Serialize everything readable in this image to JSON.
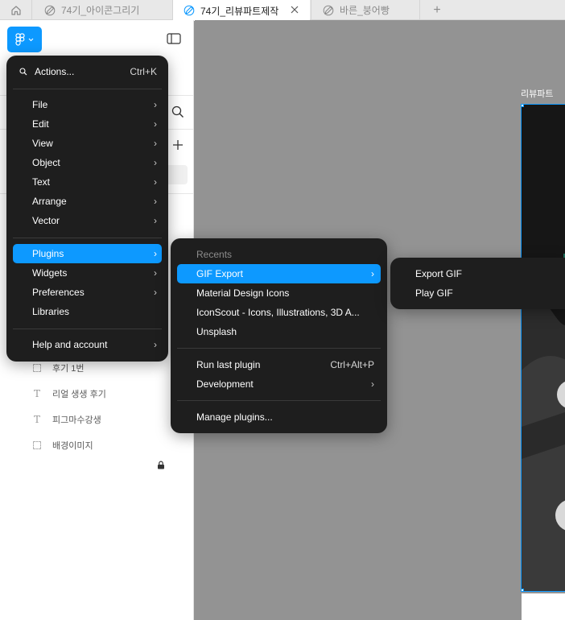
{
  "tabs": {
    "home_icon": "home-icon",
    "items": [
      {
        "label": "74기_아이콘그리기"
      },
      {
        "label": "74기_리뷰파트제작",
        "active": true
      },
      {
        "label": "바른_붕어빵"
      }
    ],
    "new_tab_symbol": "+"
  },
  "canvas": {
    "frame_label": "리뷰파트"
  },
  "layers": [
    {
      "name": "후기 1번",
      "type": "frame"
    },
    {
      "name": "리얼 생생 후기",
      "type": "text"
    },
    {
      "name": "피그마수강생",
      "type": "text"
    },
    {
      "name": "배경이미지",
      "type": "frame",
      "locked": true
    }
  ],
  "main_menu": {
    "actions": {
      "label": "Actions...",
      "shortcut": "Ctrl+K"
    },
    "group1": [
      {
        "label": "File"
      },
      {
        "label": "Edit"
      },
      {
        "label": "View"
      },
      {
        "label": "Object"
      },
      {
        "label": "Text"
      },
      {
        "label": "Arrange"
      },
      {
        "label": "Vector"
      }
    ],
    "group2": [
      {
        "label": "Plugins",
        "highlighted": true
      },
      {
        "label": "Widgets"
      },
      {
        "label": "Preferences"
      },
      {
        "label": "Libraries"
      }
    ],
    "help": {
      "label": "Help and account"
    }
  },
  "plugins_menu": {
    "recents_header": "Recents",
    "recents": [
      {
        "label": "GIF Export",
        "highlighted": true,
        "has_submenu": true
      },
      {
        "label": "Material Design Icons"
      },
      {
        "label": "IconScout - Icons, Illustrations, 3D A..."
      },
      {
        "label": "Unsplash"
      }
    ],
    "run_last": {
      "label": "Run last plugin",
      "shortcut": "Ctrl+Alt+P"
    },
    "development": {
      "label": "Development"
    },
    "manage": {
      "label": "Manage plugins..."
    }
  },
  "gif_menu": {
    "items": [
      {
        "label": "Export GIF"
      },
      {
        "label": "Play GIF"
      }
    ]
  },
  "colors": {
    "accent": "#0d99ff",
    "menu_bg": "#1e1e1e",
    "canvas_bg": "#939393"
  }
}
